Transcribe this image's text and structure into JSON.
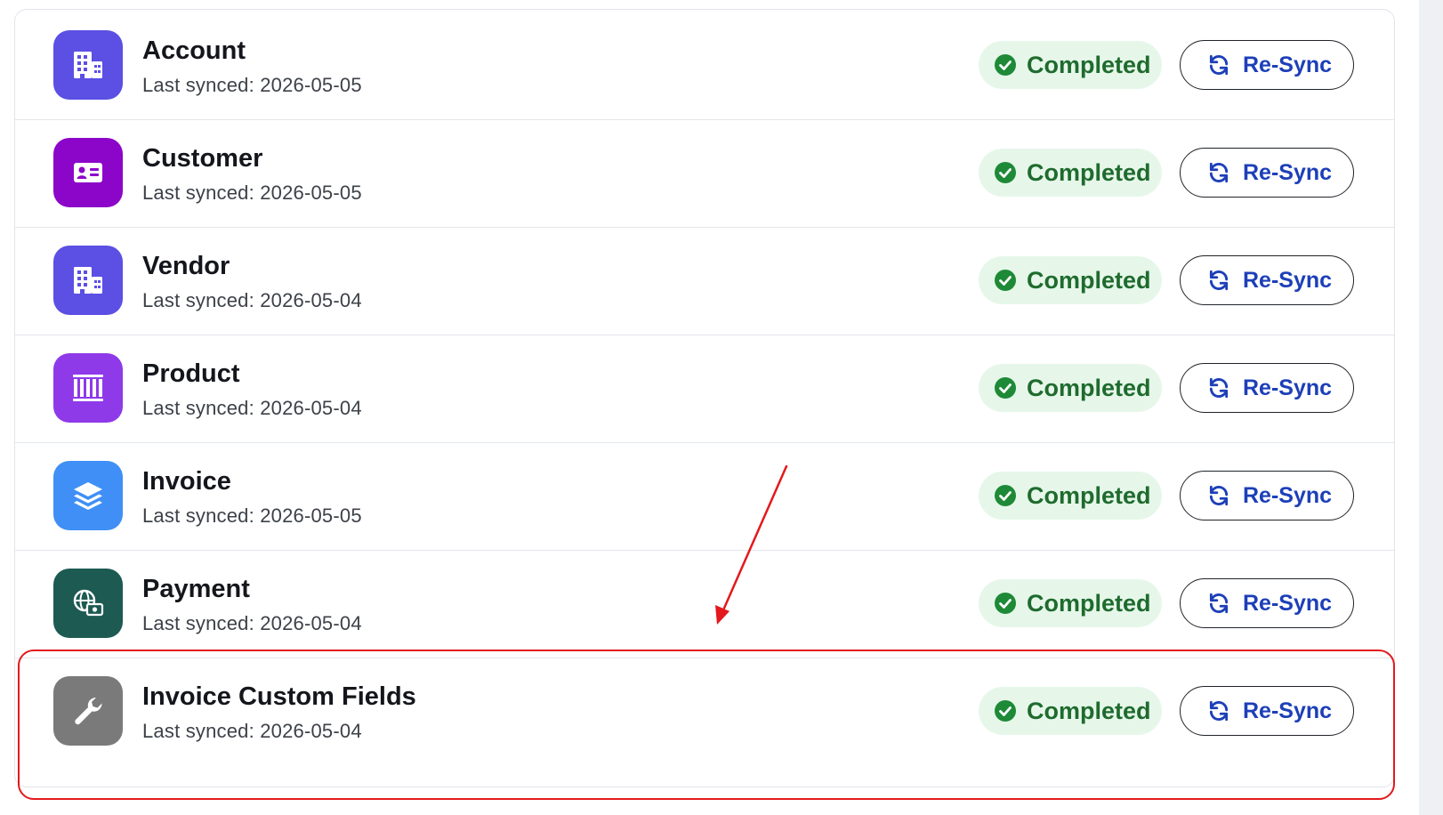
{
  "colors": {
    "accent_blue": "#1d3fb8",
    "status_green": "#1f6b2e",
    "status_bg": "#e6f7ea",
    "annotation_red": "#e3191c"
  },
  "rows": [
    {
      "name": "Account",
      "last_synced": "Last synced: 2026-05-05",
      "status": "Completed",
      "action": "Re-Sync",
      "icon": "building-icon",
      "icon_bg": "#5b4fe4"
    },
    {
      "name": "Customer",
      "last_synced": "Last synced: 2026-05-05",
      "status": "Completed",
      "action": "Re-Sync",
      "icon": "id-card-icon",
      "icon_bg": "#8c06c9"
    },
    {
      "name": "Vendor",
      "last_synced": "Last synced: 2026-05-04",
      "status": "Completed",
      "action": "Re-Sync",
      "icon": "building-icon",
      "icon_bg": "#5b4fe4"
    },
    {
      "name": "Product",
      "last_synced": "Last synced: 2026-05-04",
      "status": "Completed",
      "action": "Re-Sync",
      "icon": "barcode-icon",
      "icon_bg": "#8e3ae8"
    },
    {
      "name": "Invoice",
      "last_synced": "Last synced: 2026-05-05",
      "status": "Completed",
      "action": "Re-Sync",
      "icon": "layers-icon",
      "icon_bg": "#3f8ff6"
    },
    {
      "name": "Payment",
      "last_synced": "Last synced: 2026-05-04",
      "status": "Completed",
      "action": "Re-Sync",
      "icon": "globe-money-icon",
      "icon_bg": "#1c5a52"
    },
    {
      "name": "Invoice Custom Fields",
      "last_synced": "Last synced: 2026-05-04",
      "status": "Completed",
      "action": "Re-Sync",
      "icon": "wrench-icon",
      "icon_bg": "#7a7a7a"
    }
  ]
}
